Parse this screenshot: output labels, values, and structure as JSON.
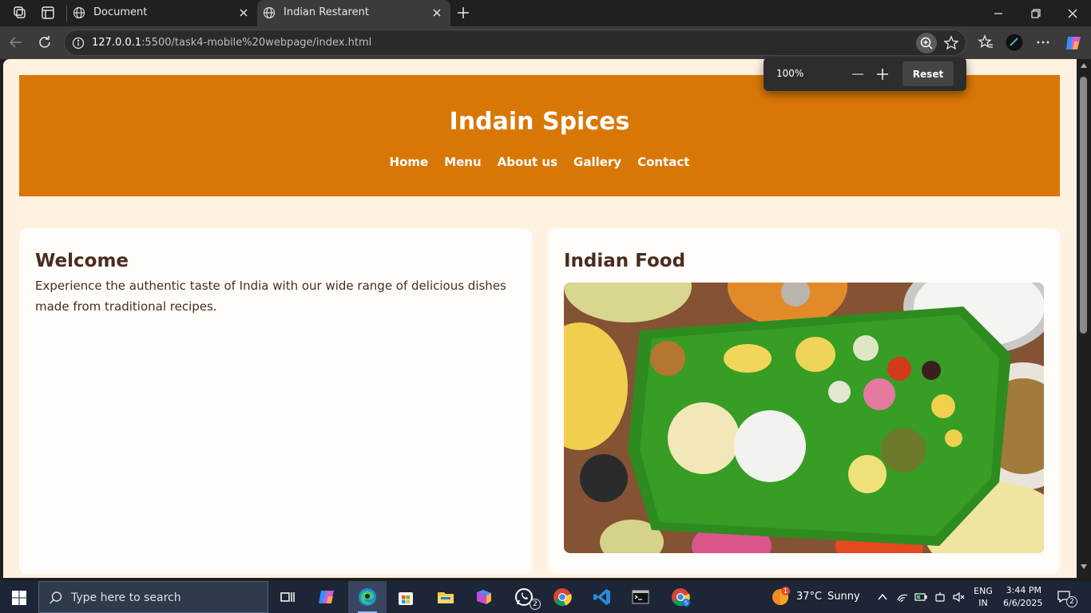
{
  "browser": {
    "tabs": [
      {
        "title": "Document",
        "active": false
      },
      {
        "title": "Indian Restarent",
        "active": true
      }
    ],
    "address": {
      "host": "127.0.0.1",
      "path": ":5500/task4-mobile%20webpage/index.html"
    },
    "zoom_popup": {
      "percent": "100%",
      "reset_label": "Reset"
    }
  },
  "site": {
    "title": "Indain Spices",
    "nav": [
      "Home",
      "Menu",
      "About us",
      "Gallery",
      "Contact"
    ],
    "welcome": {
      "heading": "Welcome",
      "text": "Experience the authentic taste of India with our wide range of delicious dishes made from traditional recipes."
    },
    "food": {
      "heading": "Indian Food",
      "image_icon": "banana-leaf-meal-photo"
    }
  },
  "colors": {
    "header_bg": "#d97706",
    "page_bg": "#fff1e0",
    "card_bg": "#fffdfa",
    "heading_text": "#4a2c1f"
  },
  "taskbar": {
    "search_placeholder": "Type here to search",
    "apps": [
      "task-view",
      "copilot",
      "edge",
      "store",
      "file-explorer",
      "m365",
      "whatsapp",
      "chrome",
      "vscode",
      "terminal",
      "chrome-profile"
    ],
    "whatsapp_badge": "2",
    "weather": {
      "temp": "37°C",
      "condition": "Sunny",
      "badge": "1"
    },
    "language": {
      "line1": "ENG",
      "line2": "IN"
    },
    "clock": {
      "time": "3:44 PM",
      "date": "6/6/2025"
    },
    "notifications": "2"
  }
}
